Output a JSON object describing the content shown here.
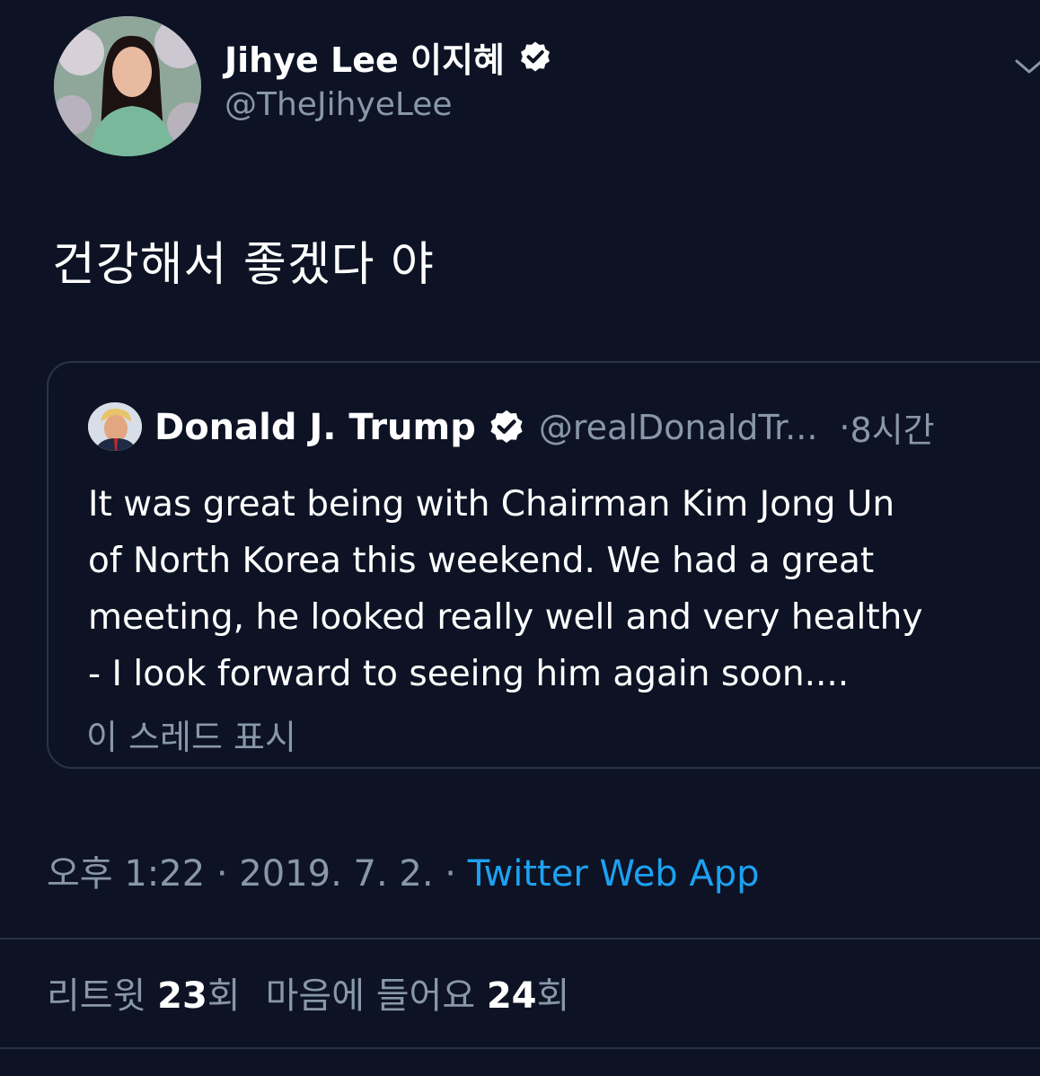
{
  "author": {
    "name": "Jihye Lee 이지혜",
    "handle": "@TheJihyeLee",
    "verified": true
  },
  "tweet": {
    "text": "건강해서 좋겠다 야",
    "timestamp": "오후 1:22 · 2019. 7. 2. · ",
    "source": "Twitter Web App"
  },
  "quoted_tweet": {
    "name": "Donald J. Trump",
    "handle": "@realDonaldTr...",
    "dot": "·",
    "time": "8시간",
    "lines": [
      "It was great being with Chairman Kim Jong Un",
      "of North Korea this weekend. We had a great",
      "meeting, he looked really well and very healthy",
      "- I look forward to seeing him again soon...."
    ],
    "show_thread": "이 스레드 표시"
  },
  "stats": {
    "retweets_label": "리트윗",
    "retweets_count": "23",
    "retweets_suffix": "회",
    "likes_label": "마음에 들어요",
    "likes_count": "24",
    "likes_suffix": "회"
  },
  "colors": {
    "background": "#0d1324",
    "link": "#1da1f2",
    "muted": "#8897a9",
    "verified": "#ffffff"
  },
  "icons": {
    "verified": "verified-badge-icon",
    "more": "chevron-down-icon"
  }
}
